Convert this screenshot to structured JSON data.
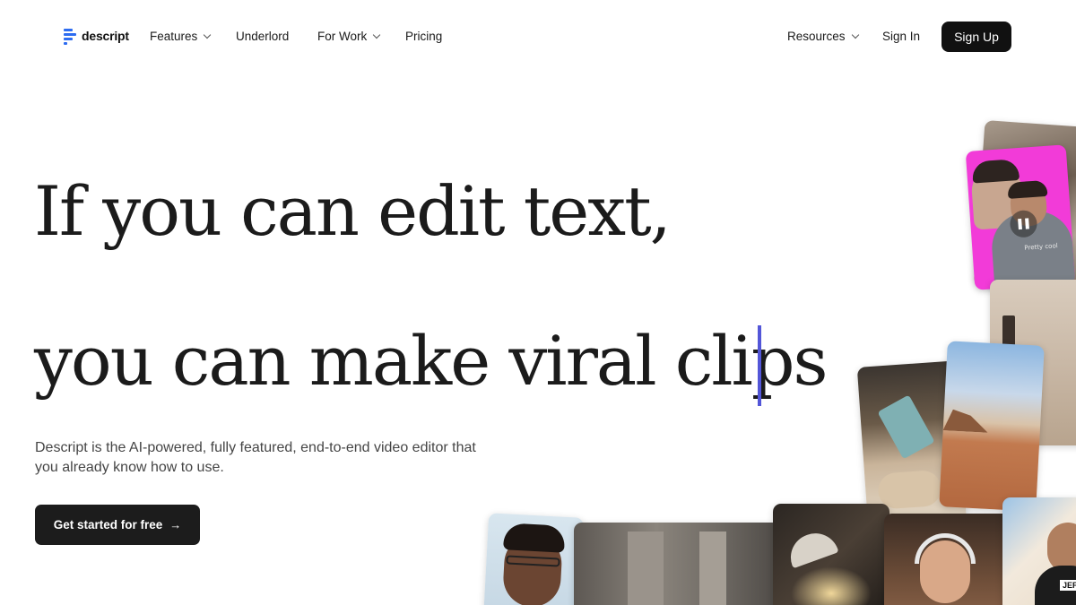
{
  "header": {
    "logo_text": "descript",
    "nav": {
      "features": "Features",
      "underlord": "Underlord",
      "for_work": "For Work",
      "pricing": "Pricing",
      "resources": "Resources"
    },
    "sign_in": "Sign In",
    "sign_up": "Sign Up"
  },
  "hero": {
    "headline_line1": "If you can edit text,",
    "headline_line2": "you can make viral clips",
    "subtitle": "Descript is the AI-powered, fully featured, end-to-end video editor that you already know how to use.",
    "cta_label": "Get started for free",
    "cta_arrow": "→"
  },
  "collage": {
    "pause_icon": "pause-icon",
    "name_tag": "JEFF",
    "shirt_text": "Pretty cool"
  },
  "colors": {
    "accent_caret": "#5356d8",
    "logo_blue": "#2d6cf0",
    "button_dark": "#111111"
  }
}
